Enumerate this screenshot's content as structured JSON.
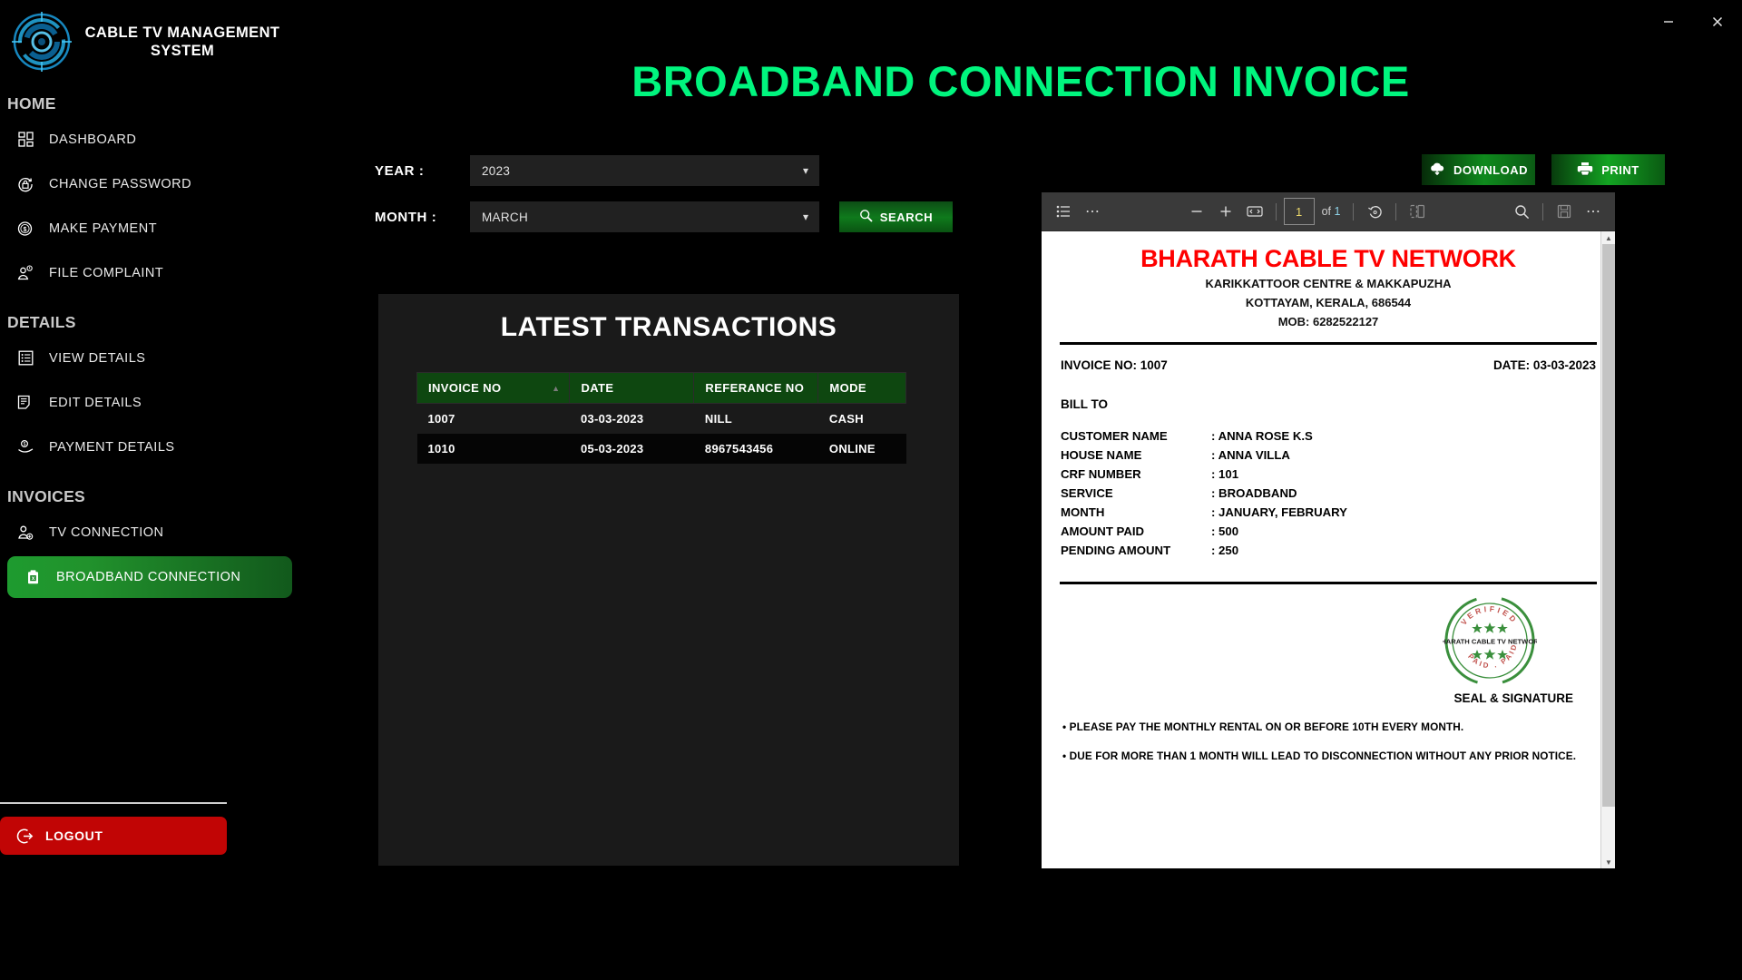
{
  "window": {
    "minimize": "–",
    "close": "✕"
  },
  "brand": {
    "title": "CABLE TV MANAGEMENT SYSTEM",
    "logo_icon": "radar-logo-icon"
  },
  "sidebar": {
    "sections": [
      {
        "label": "HOME",
        "items": [
          {
            "label": "DASHBOARD",
            "icon": "dashboard-grid-icon",
            "active": false
          },
          {
            "label": "CHANGE PASSWORD",
            "icon": "lock-refresh-icon",
            "active": false
          },
          {
            "label": "MAKE PAYMENT",
            "icon": "coin-money-icon",
            "active": false
          },
          {
            "label": "FILE COMPLAINT",
            "icon": "person-complaint-icon",
            "active": false
          }
        ]
      },
      {
        "label": "DETAILS",
        "items": [
          {
            "label": "VIEW  DETAILS",
            "icon": "list-details-icon",
            "active": false
          },
          {
            "label": "EDIT DETAILS",
            "icon": "edit-document-icon",
            "active": false
          },
          {
            "label": "PAYMENT DETAILS",
            "icon": "hand-coin-icon",
            "active": false
          }
        ]
      },
      {
        "label": "INVOICES",
        "items": [
          {
            "label": "TV CONNECTION",
            "icon": "person-add-icon",
            "active": false
          },
          {
            "label": "BROADBAND CONNECTION",
            "icon": "clipboard-x-icon",
            "active": true
          }
        ]
      }
    ],
    "logout": {
      "label": "LOGOUT",
      "icon": "logout-arrow-icon"
    }
  },
  "page": {
    "title": "BROADBAND CONNECTION INVOICE",
    "title_color": "#00f57e"
  },
  "filters": {
    "year": {
      "label": "YEAR :",
      "value": "2023"
    },
    "month": {
      "label": "MONTH :",
      "value": "MARCH"
    },
    "search_button": {
      "label": "SEARCH",
      "icon": "search-icon"
    }
  },
  "actions": [
    {
      "label": "DOWNLOAD",
      "icon": "cloud-download-icon"
    },
    {
      "label": "PRINT",
      "icon": "printer-icon"
    }
  ],
  "transactions": {
    "title": "LATEST TRANSACTIONS",
    "columns": [
      "INVOICE NO",
      "DATE",
      "REFERANCE NO",
      "MODE"
    ],
    "sorted_column": "INVOICE NO",
    "sort_arrow": "▲",
    "rows": [
      {
        "invoice_no": "1007",
        "date": "03-03-2023",
        "reference_no": "NILL",
        "mode": "CASH"
      },
      {
        "invoice_no": "1010",
        "date": "05-03-2023",
        "reference_no": "8967543456",
        "mode": "ONLINE"
      }
    ]
  },
  "pdf_viewer": {
    "toolbar": {
      "thumbnails_icon": "list-thumbnails-icon",
      "more_left_icon": "ellipsis-icon",
      "zoom_out_icon": "minus-icon",
      "zoom_in_icon": "plus-icon",
      "fit_page_icon": "fit-width-icon",
      "page_current": "1",
      "page_total_label": "of 1",
      "rotate_icon": "rotate-icon",
      "page_view_icon": "page-view-icon",
      "search_icon": "search-icon",
      "save_icon": "save-icon",
      "more_right_icon": "ellipsis-icon"
    },
    "document": {
      "company": "BHARATH CABLE TV NETWORK",
      "address_line1": "KARIKKATTOOR CENTRE & MAKKAPUZHA",
      "address_line2": "KOTTAYAM, KERALA, 686544",
      "mobile": "MOB: 6282522127",
      "invoice_no": "INVOICE NO: 1007",
      "date": "DATE: 03-03-2023",
      "bill_to_label": "BILL TO",
      "fields": [
        {
          "key": "CUSTOMER NAME",
          "value": ": ANNA ROSE K.S"
        },
        {
          "key": "HOUSE NAME",
          "value": ": ANNA VILLA"
        },
        {
          "key": "CRF NUMBER",
          "value": ": 101"
        },
        {
          "key": "SERVICE",
          "value": ": BROADBAND"
        },
        {
          "key": "MONTH",
          "value": ": JANUARY, FEBRUARY"
        },
        {
          "key": "AMOUNT PAID",
          "value": ": 500"
        },
        {
          "key": "PENDING AMOUNT",
          "value": ": 250"
        }
      ],
      "seal": {
        "top_text": "VERIFIED",
        "center_text": "BHARATH CABLE TV NETWORK",
        "bottom_text": "PAID . PAID",
        "caption": "SEAL & SIGNATURE",
        "ring_color": "#3a8f3c",
        "top_text_color": "#c2544f"
      },
      "notes": [
        "• PLEASE PAY THE MONTHLY RENTAL ON OR BEFORE 10TH EVERY MONTH.",
        "• DUE FOR MORE THAN 1 MONTH WILL LEAD TO DISCONNECTION WITHOUT ANY PRIOR NOTICE."
      ]
    }
  }
}
